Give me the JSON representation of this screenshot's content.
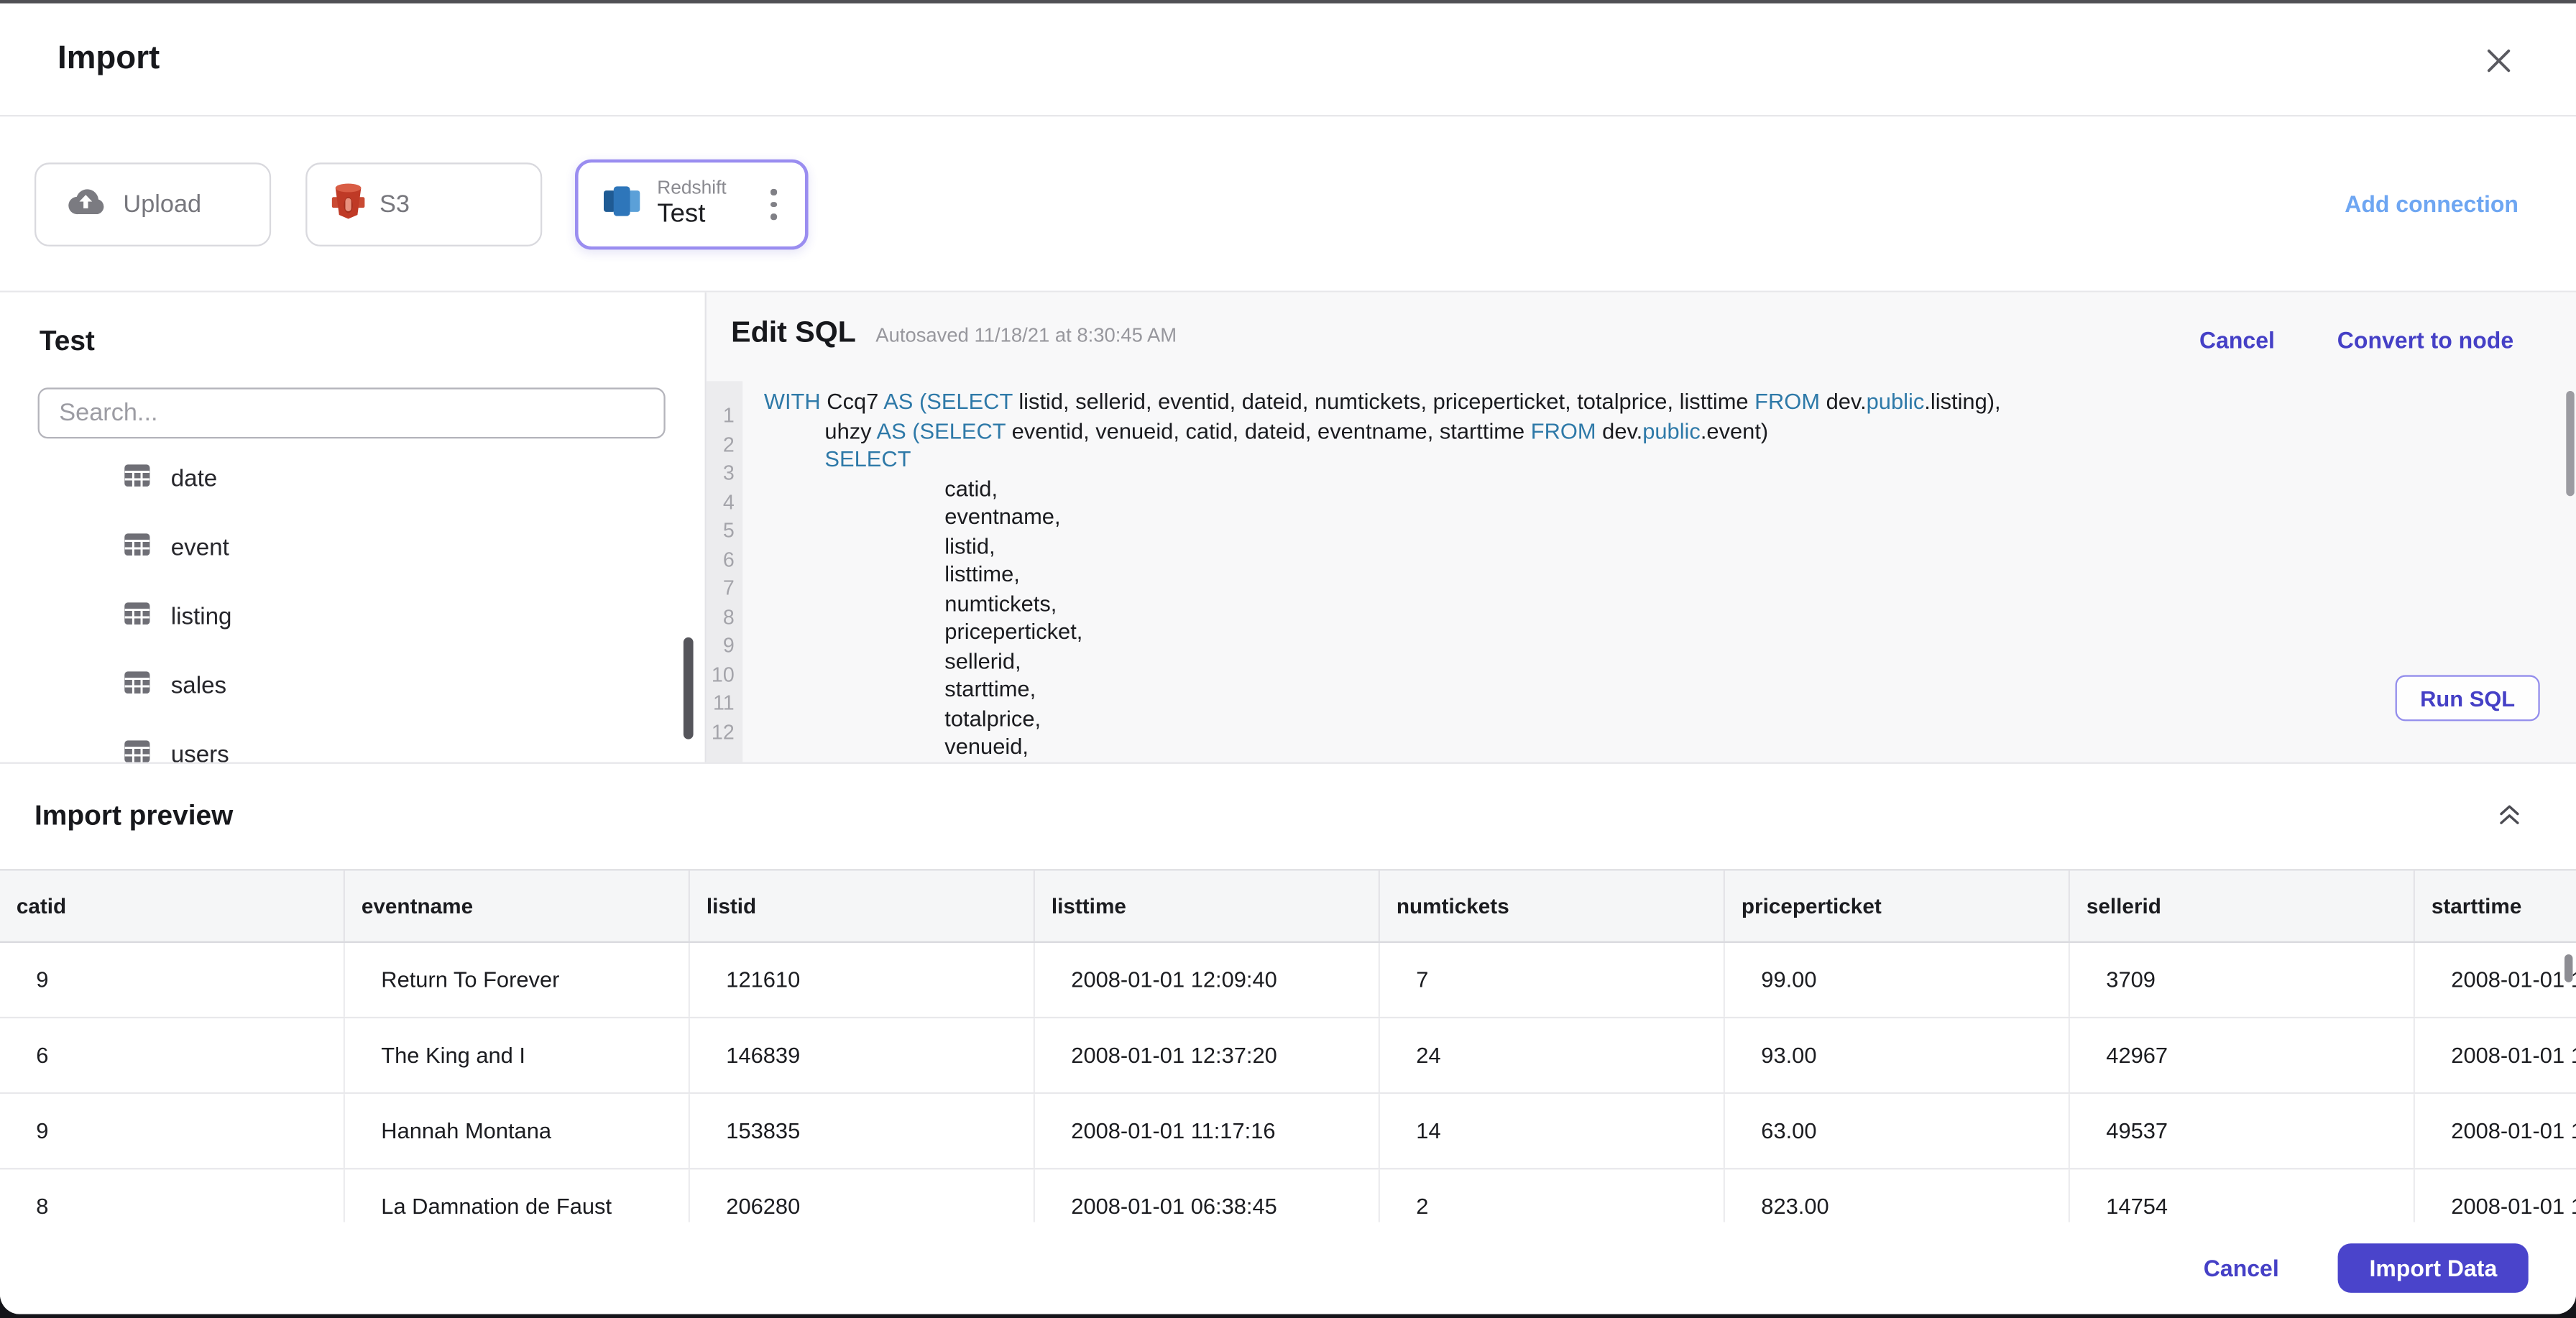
{
  "header": {
    "title": "Import"
  },
  "connections": {
    "upload_label": "Upload",
    "s3_label": "S3",
    "redshift_type": "Redshift",
    "redshift_name": "Test",
    "add_connection_label": "Add connection"
  },
  "sidebar": {
    "title": "Test",
    "search_placeholder": "Search...",
    "tables": [
      "date",
      "event",
      "listing",
      "sales",
      "users"
    ]
  },
  "sql_editor": {
    "title": "Edit SQL",
    "autosave_text": "Autosaved 11/18/21 at 8:30:45 AM",
    "cancel_label": "Cancel",
    "convert_label": "Convert to node",
    "run_label": "Run SQL",
    "line_numbers": [
      1,
      2,
      3,
      4,
      5,
      6,
      7,
      8,
      9,
      10,
      11,
      12
    ],
    "code_lines": [
      {
        "indent": 0,
        "tokens": [
          [
            "kw",
            "WITH "
          ],
          [
            "id",
            "Ccq7 "
          ],
          [
            "kw",
            "AS "
          ],
          [
            "kw",
            "("
          ],
          [
            "kw",
            "SELECT"
          ],
          [
            "id",
            " listid, sellerid, eventid, dateid, numtickets, priceperticket, totalprice, listtime "
          ],
          [
            "kw",
            "FROM "
          ],
          [
            "id",
            "dev."
          ],
          [
            "kw",
            "public"
          ],
          [
            "id",
            ".listing),"
          ]
        ]
      },
      {
        "indent": 1,
        "tokens": [
          [
            "id",
            "uhzy "
          ],
          [
            "kw",
            "AS "
          ],
          [
            "kw",
            "("
          ],
          [
            "kw",
            "SELECT"
          ],
          [
            "id",
            " eventid, venueid, catid, dateid, eventname, starttime "
          ],
          [
            "kw",
            "FROM "
          ],
          [
            "id",
            "dev."
          ],
          [
            "kw",
            "public"
          ],
          [
            "id",
            ".event)"
          ]
        ]
      },
      {
        "indent": 1,
        "tokens": [
          [
            "kw",
            "SELECT"
          ]
        ]
      },
      {
        "indent": 2,
        "tokens": [
          [
            "id",
            "catid,"
          ]
        ]
      },
      {
        "indent": 2,
        "tokens": [
          [
            "id",
            "eventname,"
          ]
        ]
      },
      {
        "indent": 2,
        "tokens": [
          [
            "id",
            "listid,"
          ]
        ]
      },
      {
        "indent": 2,
        "tokens": [
          [
            "id",
            "listtime,"
          ]
        ]
      },
      {
        "indent": 2,
        "tokens": [
          [
            "id",
            "numtickets,"
          ]
        ]
      },
      {
        "indent": 2,
        "tokens": [
          [
            "id",
            "priceperticket,"
          ]
        ]
      },
      {
        "indent": 2,
        "tokens": [
          [
            "id",
            "sellerid,"
          ]
        ]
      },
      {
        "indent": 2,
        "tokens": [
          [
            "id",
            "starttime,"
          ]
        ]
      },
      {
        "indent": 2,
        "tokens": [
          [
            "id",
            "totalprice,"
          ]
        ]
      },
      {
        "indent": 2,
        "tokens": [
          [
            "id",
            "venueid,"
          ]
        ]
      }
    ]
  },
  "preview": {
    "title": "Import preview",
    "columns": [
      "catid",
      "eventname",
      "listid",
      "listtime",
      "numtickets",
      "priceperticket",
      "sellerid",
      "starttime"
    ],
    "rows": [
      [
        "9",
        "Return To Forever",
        "121610",
        "2008-01-01 12:09:40",
        "7",
        "99.00",
        "3709",
        "2008-01-01 1"
      ],
      [
        "6",
        "The King and I",
        "146839",
        "2008-01-01 12:37:20",
        "24",
        "93.00",
        "42967",
        "2008-01-01 1"
      ],
      [
        "9",
        "Hannah Montana",
        "153835",
        "2008-01-01 11:17:16",
        "14",
        "63.00",
        "49537",
        "2008-01-01 1"
      ],
      [
        "8",
        "La Damnation de Faust",
        "206280",
        "2008-01-01 06:38:45",
        "2",
        "823.00",
        "14754",
        "2008-01-01 1"
      ]
    ]
  },
  "footer": {
    "cancel_label": "Cancel",
    "import_label": "Import Data"
  },
  "icons": {
    "close": "x-cross",
    "upload": "cloud-upload",
    "s3": "s3-bucket",
    "redshift": "redshift-database",
    "table": "table-grid",
    "kebab": "vertical-ellipsis",
    "collapse": "double-chevron-up"
  },
  "colors": {
    "accent": "#4540c6",
    "accent_fill": "#4a44cb",
    "link_blue": "#6ea6f2",
    "keyword_blue": "#2e79a8",
    "s3_red": "#bf3a26",
    "redshift_blue": "#2e76ba"
  }
}
